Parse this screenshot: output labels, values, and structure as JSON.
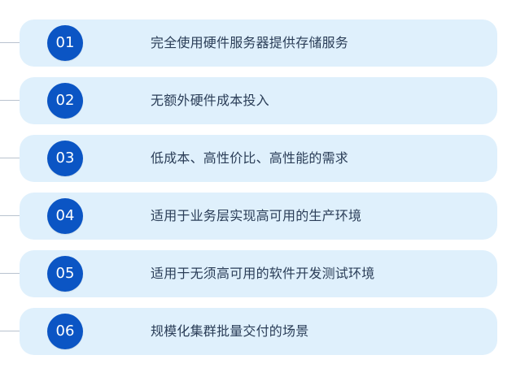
{
  "items": [
    {
      "number": "01",
      "text": "完全使用硬件服务器提供存储服务"
    },
    {
      "number": "02",
      "text": "无额外硬件成本投入"
    },
    {
      "number": "03",
      "text": "低成本、高性价比、高性能的需求"
    },
    {
      "number": "04",
      "text": "适用于业务层实现高可用的生产环境"
    },
    {
      "number": "05",
      "text": "适用于无须高可用的软件开发测试环境"
    },
    {
      "number": "06",
      "text": "规模化集群批量交付的场景"
    }
  ],
  "colors": {
    "card_background": "#dff0fc",
    "badge_background": "#0b55c4",
    "badge_text": "#ffffff",
    "label_text": "#2a3d57",
    "connector": "#b9c3cf"
  }
}
